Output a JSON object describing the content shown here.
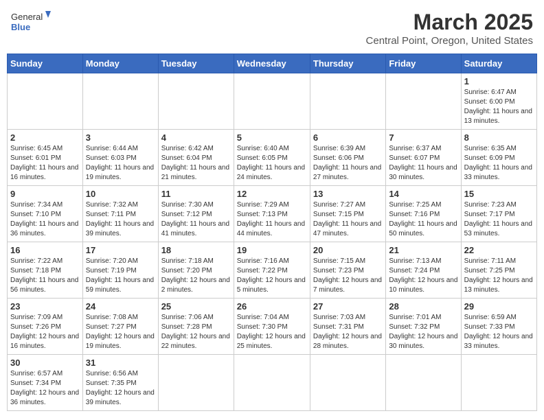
{
  "header": {
    "logo_text_general": "General",
    "logo_text_blue": "Blue",
    "title": "March 2025",
    "subtitle": "Central Point, Oregon, United States"
  },
  "weekdays": [
    "Sunday",
    "Monday",
    "Tuesday",
    "Wednesday",
    "Thursday",
    "Friday",
    "Saturday"
  ],
  "weeks": [
    [
      {
        "day": "",
        "info": ""
      },
      {
        "day": "",
        "info": ""
      },
      {
        "day": "",
        "info": ""
      },
      {
        "day": "",
        "info": ""
      },
      {
        "day": "",
        "info": ""
      },
      {
        "day": "",
        "info": ""
      },
      {
        "day": "1",
        "info": "Sunrise: 6:47 AM\nSunset: 6:00 PM\nDaylight: 11 hours and 13 minutes."
      }
    ],
    [
      {
        "day": "2",
        "info": "Sunrise: 6:45 AM\nSunset: 6:01 PM\nDaylight: 11 hours and 16 minutes."
      },
      {
        "day": "3",
        "info": "Sunrise: 6:44 AM\nSunset: 6:03 PM\nDaylight: 11 hours and 19 minutes."
      },
      {
        "day": "4",
        "info": "Sunrise: 6:42 AM\nSunset: 6:04 PM\nDaylight: 11 hours and 21 minutes."
      },
      {
        "day": "5",
        "info": "Sunrise: 6:40 AM\nSunset: 6:05 PM\nDaylight: 11 hours and 24 minutes."
      },
      {
        "day": "6",
        "info": "Sunrise: 6:39 AM\nSunset: 6:06 PM\nDaylight: 11 hours and 27 minutes."
      },
      {
        "day": "7",
        "info": "Sunrise: 6:37 AM\nSunset: 6:07 PM\nDaylight: 11 hours and 30 minutes."
      },
      {
        "day": "8",
        "info": "Sunrise: 6:35 AM\nSunset: 6:09 PM\nDaylight: 11 hours and 33 minutes."
      }
    ],
    [
      {
        "day": "9",
        "info": "Sunrise: 7:34 AM\nSunset: 7:10 PM\nDaylight: 11 hours and 36 minutes."
      },
      {
        "day": "10",
        "info": "Sunrise: 7:32 AM\nSunset: 7:11 PM\nDaylight: 11 hours and 39 minutes."
      },
      {
        "day": "11",
        "info": "Sunrise: 7:30 AM\nSunset: 7:12 PM\nDaylight: 11 hours and 41 minutes."
      },
      {
        "day": "12",
        "info": "Sunrise: 7:29 AM\nSunset: 7:13 PM\nDaylight: 11 hours and 44 minutes."
      },
      {
        "day": "13",
        "info": "Sunrise: 7:27 AM\nSunset: 7:15 PM\nDaylight: 11 hours and 47 minutes."
      },
      {
        "day": "14",
        "info": "Sunrise: 7:25 AM\nSunset: 7:16 PM\nDaylight: 11 hours and 50 minutes."
      },
      {
        "day": "15",
        "info": "Sunrise: 7:23 AM\nSunset: 7:17 PM\nDaylight: 11 hours and 53 minutes."
      }
    ],
    [
      {
        "day": "16",
        "info": "Sunrise: 7:22 AM\nSunset: 7:18 PM\nDaylight: 11 hours and 56 minutes."
      },
      {
        "day": "17",
        "info": "Sunrise: 7:20 AM\nSunset: 7:19 PM\nDaylight: 11 hours and 59 minutes."
      },
      {
        "day": "18",
        "info": "Sunrise: 7:18 AM\nSunset: 7:20 PM\nDaylight: 12 hours and 2 minutes."
      },
      {
        "day": "19",
        "info": "Sunrise: 7:16 AM\nSunset: 7:22 PM\nDaylight: 12 hours and 5 minutes."
      },
      {
        "day": "20",
        "info": "Sunrise: 7:15 AM\nSunset: 7:23 PM\nDaylight: 12 hours and 7 minutes."
      },
      {
        "day": "21",
        "info": "Sunrise: 7:13 AM\nSunset: 7:24 PM\nDaylight: 12 hours and 10 minutes."
      },
      {
        "day": "22",
        "info": "Sunrise: 7:11 AM\nSunset: 7:25 PM\nDaylight: 12 hours and 13 minutes."
      }
    ],
    [
      {
        "day": "23",
        "info": "Sunrise: 7:09 AM\nSunset: 7:26 PM\nDaylight: 12 hours and 16 minutes."
      },
      {
        "day": "24",
        "info": "Sunrise: 7:08 AM\nSunset: 7:27 PM\nDaylight: 12 hours and 19 minutes."
      },
      {
        "day": "25",
        "info": "Sunrise: 7:06 AM\nSunset: 7:28 PM\nDaylight: 12 hours and 22 minutes."
      },
      {
        "day": "26",
        "info": "Sunrise: 7:04 AM\nSunset: 7:30 PM\nDaylight: 12 hours and 25 minutes."
      },
      {
        "day": "27",
        "info": "Sunrise: 7:03 AM\nSunset: 7:31 PM\nDaylight: 12 hours and 28 minutes."
      },
      {
        "day": "28",
        "info": "Sunrise: 7:01 AM\nSunset: 7:32 PM\nDaylight: 12 hours and 30 minutes."
      },
      {
        "day": "29",
        "info": "Sunrise: 6:59 AM\nSunset: 7:33 PM\nDaylight: 12 hours and 33 minutes."
      }
    ],
    [
      {
        "day": "30",
        "info": "Sunrise: 6:57 AM\nSunset: 7:34 PM\nDaylight: 12 hours and 36 minutes."
      },
      {
        "day": "31",
        "info": "Sunrise: 6:56 AM\nSunset: 7:35 PM\nDaylight: 12 hours and 39 minutes."
      },
      {
        "day": "",
        "info": ""
      },
      {
        "day": "",
        "info": ""
      },
      {
        "day": "",
        "info": ""
      },
      {
        "day": "",
        "info": ""
      },
      {
        "day": "",
        "info": ""
      }
    ]
  ]
}
